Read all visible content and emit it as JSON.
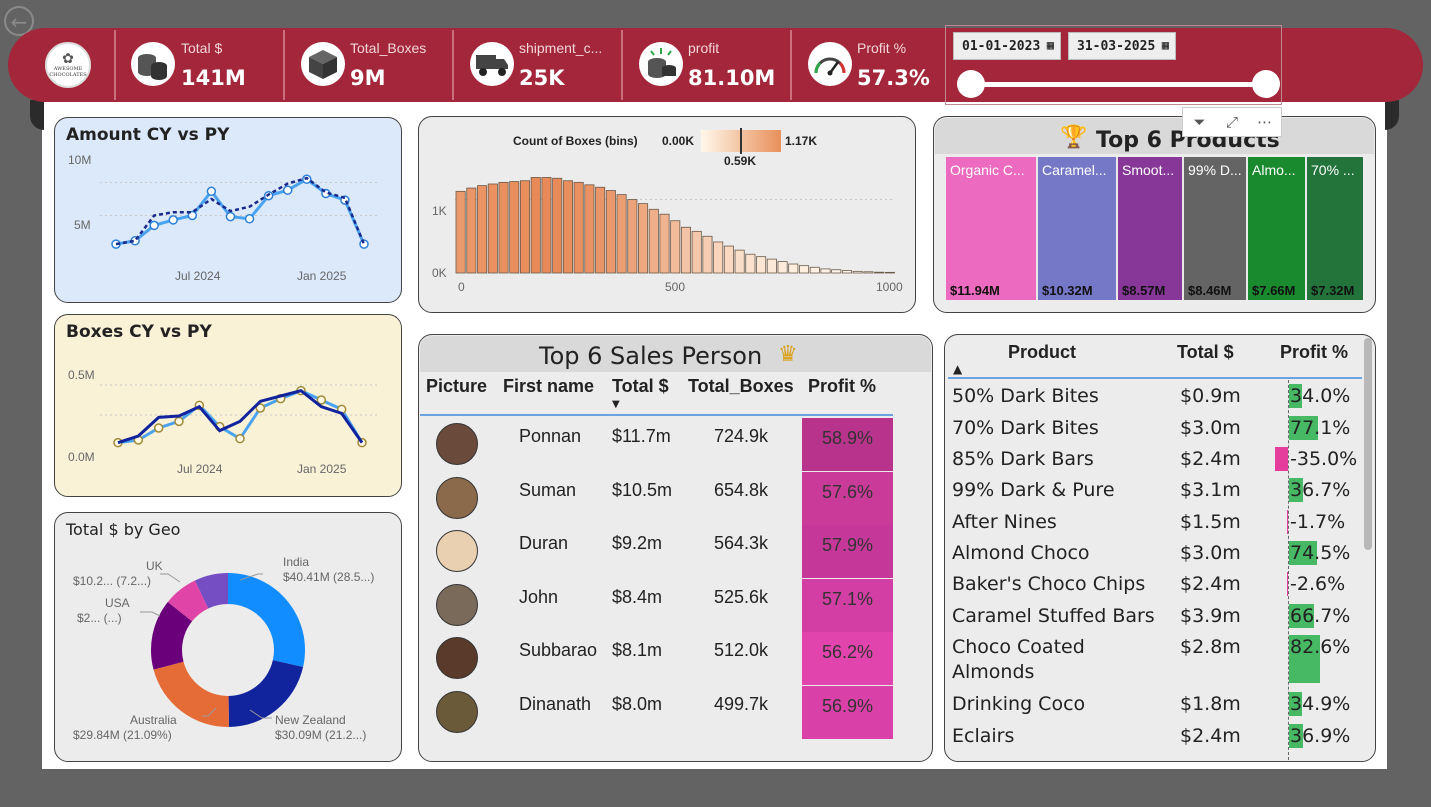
{
  "header": {
    "back_icon": "back-arrow-icon",
    "logo": {
      "line1": "AWESOME",
      "line2": "CHOCOLATES"
    },
    "kpis": [
      {
        "label": "Total $",
        "value": "141M",
        "icon": "coins-icon"
      },
      {
        "label": "Total_Boxes",
        "value": "9M",
        "icon": "box-icon"
      },
      {
        "label": "shipment_c...",
        "value": "25K",
        "icon": "truck-icon"
      },
      {
        "label": "profit",
        "value": "81.10M",
        "icon": "coins-sparkle-icon"
      },
      {
        "label": "Profit %",
        "value": "57.3%",
        "icon": "gauge-icon"
      }
    ],
    "date_from": "01-01-2023",
    "date_to": "31-03-2025"
  },
  "colors": {
    "brand": "#a3263a",
    "pink": "#e53d9c",
    "green": "#47b863"
  },
  "amount_chart": {
    "title": "Amount CY vs PY",
    "y_ticks": [
      "10M",
      "5M"
    ],
    "x_ticks": [
      "Jul 2024",
      "Jan 2025"
    ],
    "chart_data": {
      "type": "line",
      "x": [
        "Jan 2024",
        "Feb 2024",
        "Mar 2024",
        "Apr 2024",
        "May 2024",
        "Jun 2024",
        "Jul 2024",
        "Aug 2024",
        "Sep 2024",
        "Oct 2024",
        "Nov 2024",
        "Dec 2024",
        "Jan 2025",
        "Feb 2025",
        "Mar 2025"
      ],
      "series": [
        {
          "values": [
            1.9,
            2.2,
            3.6,
            4.1,
            4.5,
            6.7,
            4.4,
            4.2,
            6.3,
            6.8,
            7.8,
            6.5,
            5.9,
            1.9
          ]
        },
        {
          "values": [
            1.9,
            2.2,
            4.5,
            4.8,
            4.8,
            6.0,
            4.9,
            5.3,
            6.4,
            7.4,
            7.9,
            6.6,
            6.1,
            1.9
          ]
        }
      ],
      "ylim": [
        0,
        10
      ]
    }
  },
  "boxes_chart": {
    "title": "Boxes CY vs PY",
    "y_ticks": [
      "0.5M",
      "0.0M"
    ],
    "x_ticks": [
      "Jul 2024",
      "Jan 2025"
    ],
    "chart_data": {
      "type": "line",
      "x": [
        "Jan 2024",
        "Feb 2024",
        "Mar 2024",
        "Apr 2024",
        "May 2024",
        "Jun 2024",
        "Jul 2024",
        "Aug 2024",
        "Sep 2024",
        "Oct 2024",
        "Nov 2024",
        "Dec 2024",
        "Jan 2025",
        "Feb 2025"
      ],
      "series": [
        {
          "values": [
            0.13,
            0.15,
            0.24,
            0.29,
            0.41,
            0.25,
            0.16,
            0.39,
            0.46,
            0.52,
            0.45,
            0.38,
            0.13
          ]
        },
        {
          "values": [
            0.13,
            0.18,
            0.32,
            0.33,
            0.4,
            0.22,
            0.29,
            0.44,
            0.48,
            0.52,
            0.4,
            0.35,
            0.13
          ]
        }
      ],
      "ylim": [
        0,
        0.75
      ]
    }
  },
  "geo_chart": {
    "title": "Total $ by Geo",
    "chart_data": {
      "type": "pie",
      "slices": [
        {
          "name": "India",
          "label": "$40.41M (28.5...)",
          "value": 40.41,
          "color": "#118dff"
        },
        {
          "name": "New Zealand",
          "label": "$30.09M (21.2...)",
          "value": 30.09,
          "color": "#12239e"
        },
        {
          "name": "Australia",
          "label": "$29.84M (21.09%)",
          "value": 29.84,
          "color": "#e66c37"
        },
        {
          "name": "USA",
          "label": "$2... (...)",
          "value": 21.0,
          "color": "#6b007b"
        },
        {
          "name": "UK",
          "label": "$10.2... (7.2...)",
          "value": 10.2,
          "color": "#e044a7"
        },
        {
          "name": "",
          "label": "",
          "value": 10.0,
          "color": "#744ec2"
        }
      ]
    }
  },
  "histogram": {
    "legend_title": "Count of Boxes (bins)",
    "legend_min": "0.00K",
    "legend_max": "1.17K",
    "legend_mid": "0.59K",
    "y_ticks": [
      "1K",
      "0K"
    ],
    "x_ticks": [
      "0",
      "500",
      "1000"
    ],
    "chart_data": {
      "type": "bar",
      "values": [
        1000,
        1040,
        1070,
        1090,
        1110,
        1120,
        1130,
        1170,
        1170,
        1160,
        1130,
        1110,
        1080,
        1050,
        1010,
        960,
        900,
        850,
        780,
        720,
        640,
        560,
        510,
        450,
        380,
        330,
        280,
        230,
        200,
        170,
        140,
        110,
        90,
        70,
        50,
        40,
        30,
        20,
        15,
        10,
        8
      ]
    }
  },
  "products": {
    "title": "Top 6 Products",
    "trophy_icon": "trophy-icon",
    "items": [
      {
        "name": "Organic C...",
        "value": "$11.94M",
        "color": "#ec6ac0"
      },
      {
        "name": "Caramel...",
        "value": "$10.32M",
        "color": "#7478c6"
      },
      {
        "name": "Smoot...",
        "value": "$8.57M",
        "color": "#873798"
      },
      {
        "name": "99% D...",
        "value": "$8.46M",
        "color": "#646464"
      },
      {
        "name": "Almo...",
        "value": "$7.66M",
        "color": "#1a8a2f"
      },
      {
        "name": "70% ...",
        "value": "$7.32M",
        "color": "#23743a"
      }
    ]
  },
  "sales": {
    "title": "Top 6 Sales Person",
    "crown_icon": "crown-icon",
    "columns": [
      "Picture",
      "First name",
      "Total $",
      "Total_Boxes",
      "Profit %"
    ],
    "rows": [
      {
        "name": "Ponnan",
        "total": "$11.7m",
        "boxes": "724.9k",
        "pct": "58.9%",
        "color": "#b8338b"
      },
      {
        "name": "Suman",
        "total": "$10.5m",
        "boxes": "654.8k",
        "pct": "57.6%",
        "color": "#c93a99"
      },
      {
        "name": "Duran",
        "total": "$9.2m",
        "boxes": "564.3k",
        "pct": "57.9%",
        "color": "#c5389a"
      },
      {
        "name": "John",
        "total": "$8.4m",
        "boxes": "525.6k",
        "pct": "57.1%",
        "color": "#d23ea3"
      },
      {
        "name": "Subbarao",
        "total": "$8.1m",
        "boxes": "512.0k",
        "pct": "56.2%",
        "color": "#e244ad"
      },
      {
        "name": "Dinanath",
        "total": "$8.0m",
        "boxes": "499.7k",
        "pct": "56.9%",
        "color": "#d940a8"
      }
    ]
  },
  "product_table": {
    "columns": [
      "Product",
      "Total $",
      "Profit %"
    ],
    "rows": [
      {
        "name": "50% Dark Bites",
        "total": "$0.9m",
        "pct": "34.0%",
        "v": 34.0
      },
      {
        "name": "70% Dark Bites",
        "total": "$3.0m",
        "pct": "77.1%",
        "v": 77.1
      },
      {
        "name": "85% Dark Bars",
        "total": "$2.4m",
        "pct": "-35.0%",
        "v": -35.0
      },
      {
        "name": "99% Dark & Pure",
        "total": "$3.1m",
        "pct": "36.7%",
        "v": 36.7
      },
      {
        "name": "After Nines",
        "total": "$1.5m",
        "pct": "-1.7%",
        "v": -1.7
      },
      {
        "name": "Almond Choco",
        "total": "$3.0m",
        "pct": "74.5%",
        "v": 74.5
      },
      {
        "name": "Baker's Choco Chips",
        "total": "$2.4m",
        "pct": "-2.6%",
        "v": -2.6
      },
      {
        "name": "Caramel Stuffed Bars",
        "total": "$3.9m",
        "pct": "66.7%",
        "v": 66.7
      },
      {
        "name": "Choco Coated",
        "name2": "Almonds",
        "total": "$2.8m",
        "pct": "82.6%",
        "v": 82.6
      },
      {
        "name": "Drinking Coco",
        "total": "$1.8m",
        "pct": "34.9%",
        "v": 34.9
      },
      {
        "name": "Eclairs",
        "total": "$2.4m",
        "pct": "36.9%",
        "v": 36.9
      }
    ]
  }
}
